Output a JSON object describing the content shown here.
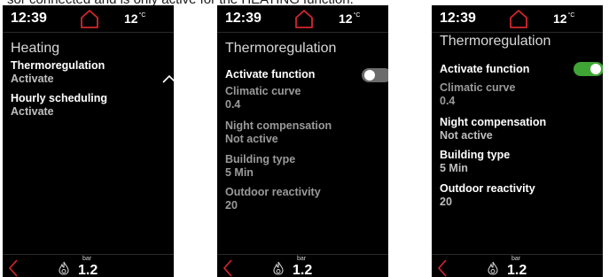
{
  "caption": "sor connected and is only active for the HEATING function.",
  "status": {
    "time": "12:39",
    "temp": "12",
    "temp_unit": "°C"
  },
  "bottom": {
    "pressure": "1.2",
    "unit": "bar"
  },
  "screen1": {
    "title": "Heating",
    "items": [
      {
        "label": "Thermoregulation",
        "value": "Activate"
      },
      {
        "label": "Hourly scheduling",
        "value": "Activate"
      }
    ]
  },
  "screen2": {
    "title": "Thermoregulation",
    "toggle_label": "Activate function",
    "toggle_state": "off",
    "items": [
      {
        "label": "Climatic curve",
        "value": "0.4"
      },
      {
        "label": "Night compensation",
        "value": "Not active"
      },
      {
        "label": "Building type",
        "value": "5 Min"
      },
      {
        "label": "Outdoor reactivity",
        "value": "20"
      }
    ]
  },
  "screen3": {
    "title": "Thermoregulation",
    "toggle_label": "Activate function",
    "toggle_state": "on",
    "items": [
      {
        "label": "Climatic curve",
        "value": "0.4"
      },
      {
        "label": "Night compensation",
        "value": "Not active"
      },
      {
        "label": "Building type",
        "value": "5 Min"
      },
      {
        "label": "Outdoor reactivity",
        "value": "20"
      }
    ]
  },
  "colors": {
    "accent_red": "#d4272e",
    "toggle_on": "#3fa535",
    "toggle_off": "#6b6b6b"
  },
  "icons": [
    "home-icon",
    "chevron-up-icon",
    "back-arrow-icon",
    "flame-icon"
  ]
}
